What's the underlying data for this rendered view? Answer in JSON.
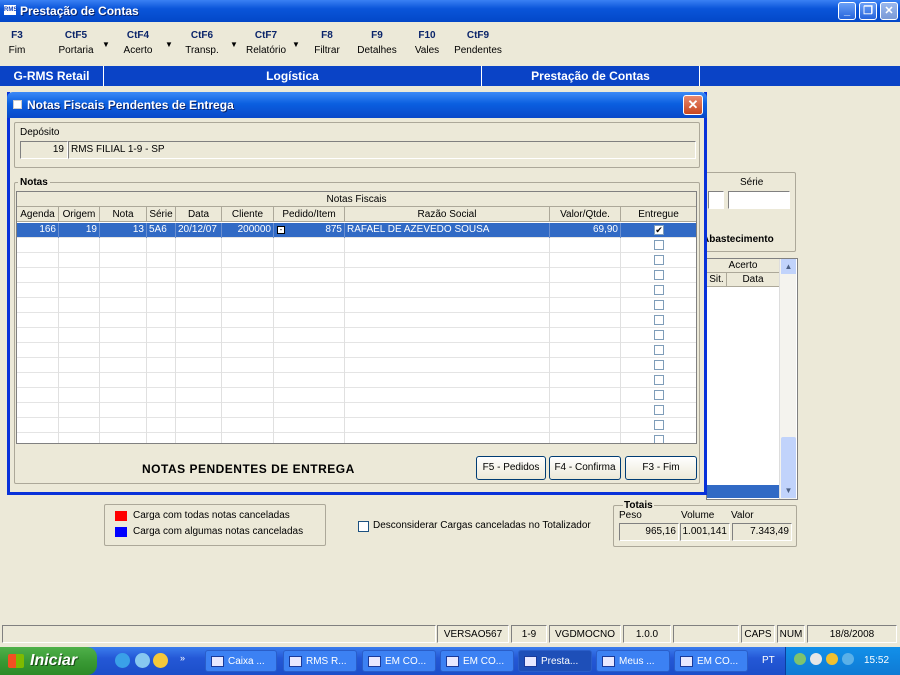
{
  "app": {
    "title": "Prestação de Contas",
    "logo_text": "RMS"
  },
  "toolbar": {
    "items": [
      {
        "key": "F3",
        "label": "Fim"
      },
      {
        "key": "CtF5",
        "label": "Portaria"
      },
      {
        "key": "CtF4",
        "label": "Acerto"
      },
      {
        "key": "CtF6",
        "label": "Transp."
      },
      {
        "key": "CtF7",
        "label": "Relatório"
      },
      {
        "key": "F8",
        "label": "Filtrar"
      },
      {
        "key": "F9",
        "label": "Detalhes"
      },
      {
        "key": "F10",
        "label": "Vales"
      },
      {
        "key": "CtF9",
        "label": "Pendentes"
      }
    ]
  },
  "header_bar": {
    "cells": [
      "G-RMS Retail",
      "Logística",
      "Prestação de Contas"
    ]
  },
  "background": {
    "serie_label": "Série",
    "abastecimento_label": "Abastecimento",
    "acerto_label": "Acerto",
    "sit_label": "Sit.",
    "data_label": "Data"
  },
  "dialog": {
    "title": "Notas Fiscais Pendentes de Entrega",
    "deposito_label": "Depósito",
    "deposito_code": "19",
    "deposito_name": "RMS FILIAL 1-9 - SP",
    "notas_label": "Notas",
    "grid_title": "Notas Fiscais",
    "columns": [
      "Agenda",
      "Origem",
      "Nota",
      "Série",
      "Data",
      "Cliente",
      "Pedido/Item",
      "Razão Social",
      "Valor/Qtde.",
      "Entregue"
    ],
    "rows": [
      {
        "agenda": "166",
        "origem": "19",
        "nota": "13",
        "serie": "5A6",
        "data": "20/12/07",
        "cliente": "200000",
        "pedido_item": "875",
        "razao": "RAFAEL DE AZEVEDO SOUSA",
        "valor": "69,90",
        "entregue": true
      }
    ],
    "empty_rows": 14,
    "footer_label": "NOTAS PENDENTES DE ENTREGA",
    "btn_pedidos": "F5 - Pedidos",
    "btn_confirma": "F4 - Confirma",
    "btn_fim": "F3 - Fim"
  },
  "legend": {
    "item1": "Carga com todas notas canceladas",
    "item2": "Carga com algumas notas canceladas",
    "color1": "#ff0000",
    "color2": "#0000ff"
  },
  "desconsiderar_label": "Desconsiderar Cargas canceladas no Totalizador",
  "totais": {
    "title": "Totais",
    "peso_label": "Peso",
    "volume_label": "Volume",
    "valor_label": "Valor",
    "peso": "965,16",
    "volume": "1.001,141",
    "valor": "7.343,49"
  },
  "statusbar": {
    "versao": "VERSAO567",
    "filial": "1-9",
    "user": "VGDMOCNO",
    "ver": "1.0.0",
    "caps": "CAPS",
    "num": "NUM",
    "date": "18/8/2008"
  },
  "taskbar": {
    "start": "Iniciar",
    "tasks": [
      "Caixa ...",
      "RMS R...",
      "EM CO...",
      "EM CO...",
      "Presta...",
      "Meus ...",
      "EM CO..."
    ],
    "lang": "PT",
    "clock": "15:52"
  }
}
